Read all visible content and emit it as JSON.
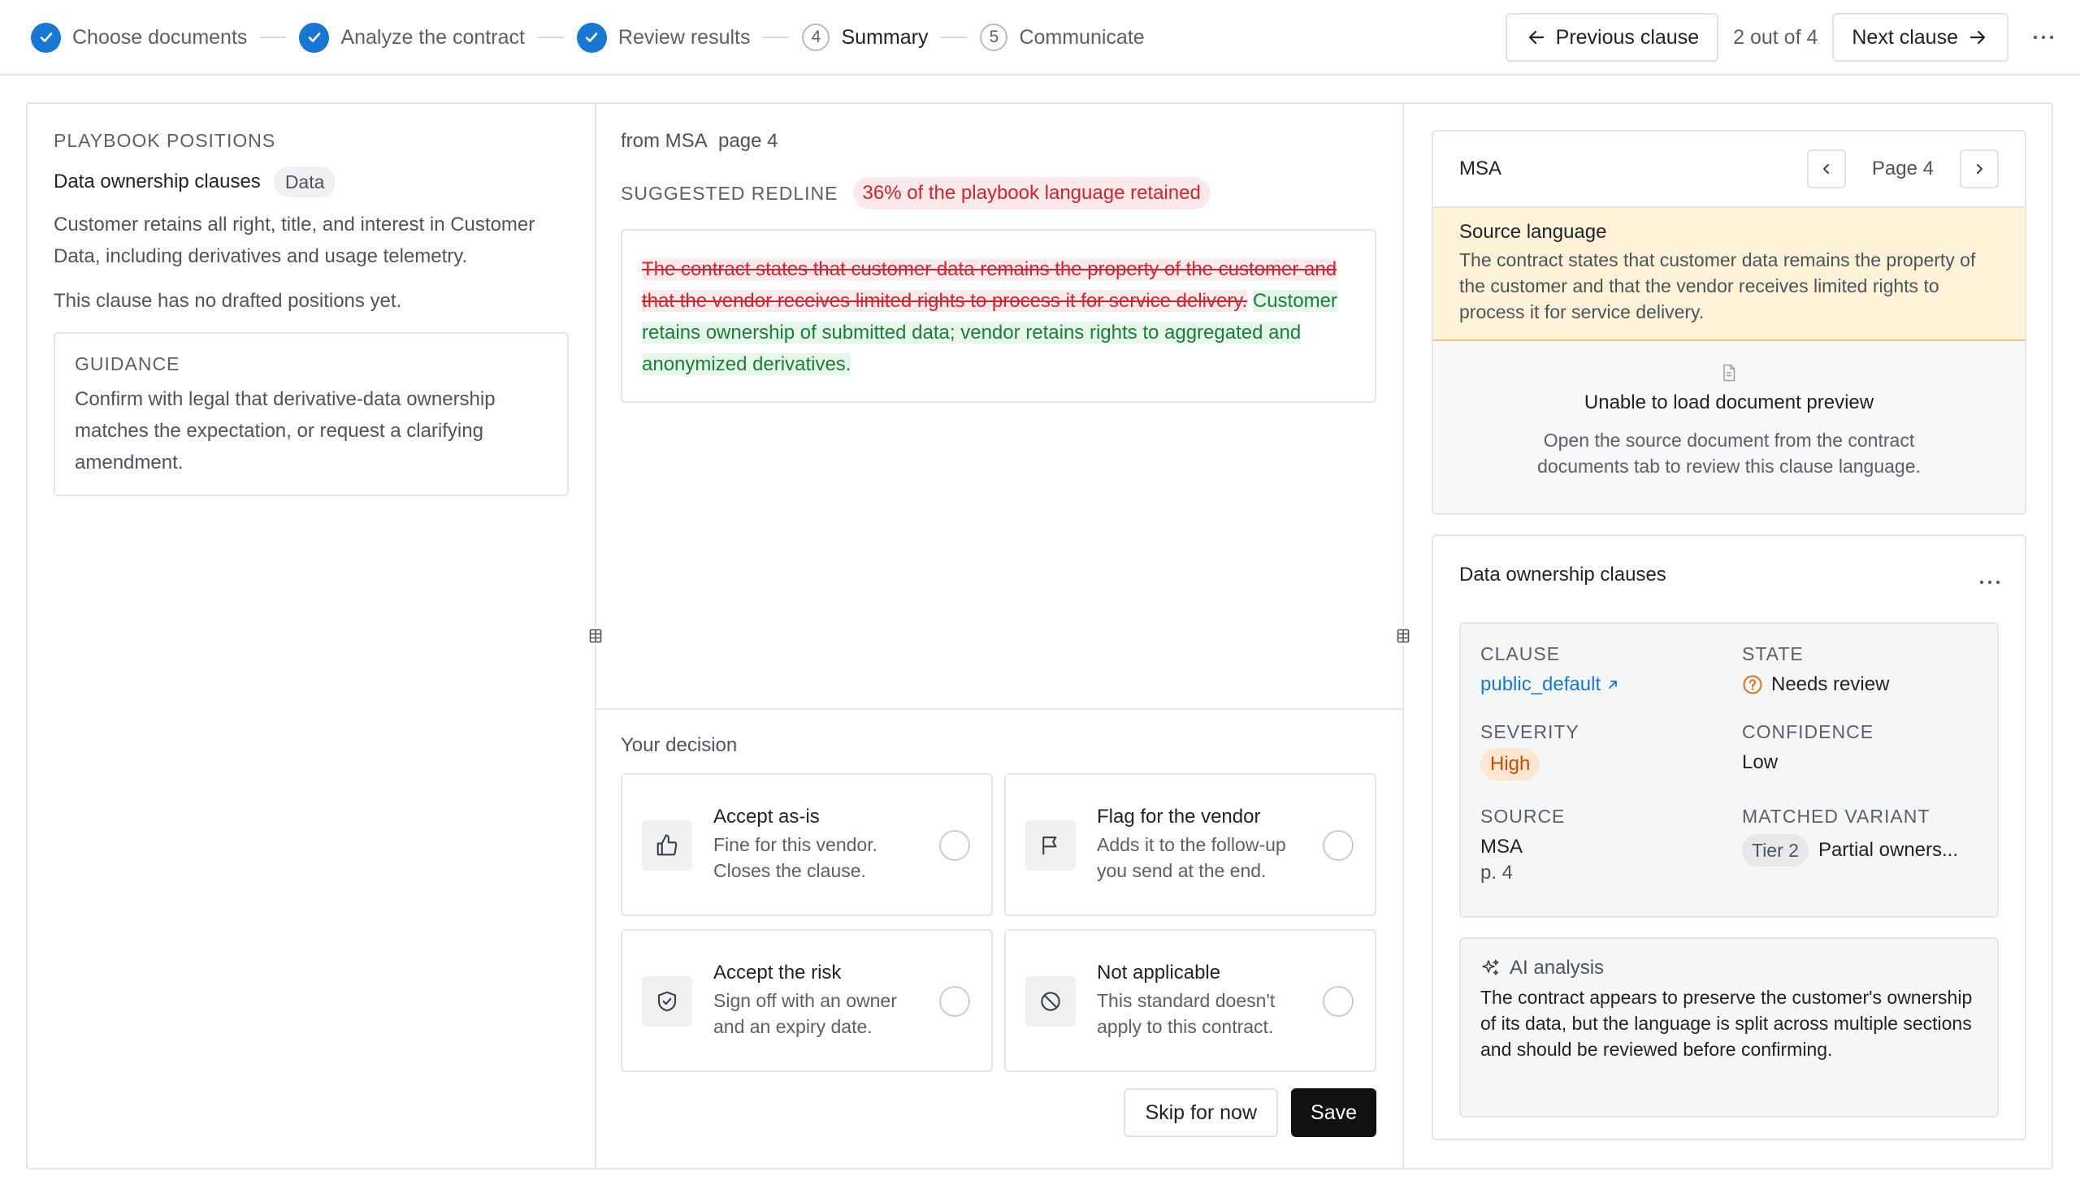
{
  "steps": [
    {
      "label": "Choose documents",
      "state": "done"
    },
    {
      "label": "Analyze the contract",
      "state": "done"
    },
    {
      "label": "Review results",
      "state": "done"
    },
    {
      "label": "Summary",
      "number": "4",
      "state": "current"
    },
    {
      "label": "Communicate",
      "number": "5",
      "state": "upcoming"
    }
  ],
  "nav": {
    "previous_label": "Previous clause",
    "counter": "2 out of 4",
    "next_label": "Next clause"
  },
  "playbook": {
    "section_title": "PLAYBOOK POSITIONS",
    "clause_name": "Data ownership clauses",
    "tag": "Data",
    "position_text": "Customer retains all right, title, and interest in Customer Data, including derivatives and usage telemetry.",
    "empty_note": "This clause has no drafted positions yet.",
    "guidance_title": "GUIDANCE",
    "guidance_text": "Confirm with legal that derivative-data ownership matches the expectation, or request a clarifying amendment."
  },
  "redline": {
    "from": "from MSA",
    "page": "page 4",
    "label": "SUGGESTED REDLINE",
    "retained": "36% of the playbook language retained",
    "deleted": "The contract states that customer data remains the property of the customer and that the vendor receives limited rights to process it for service delivery.",
    "inserted": "Customer retains ownership of submitted data; vendor retains rights to aggregated and anonymized derivatives."
  },
  "decision": {
    "label": "Your decision",
    "options": [
      {
        "title": "Accept as-is",
        "desc": "Fine for this vendor. Closes the clause.",
        "icon": "thumbs-up-icon"
      },
      {
        "title": "Flag for the vendor",
        "desc": "Adds it to the follow-up you send at the end.",
        "icon": "flag-icon"
      },
      {
        "title": "Accept the risk",
        "desc": "Sign off with an owner and an expiry date.",
        "icon": "shield-check-icon"
      },
      {
        "title": "Not applicable",
        "desc": "This standard doesn't apply to this contract.",
        "icon": "prohibited-icon"
      }
    ],
    "skip_label": "Skip for now",
    "save_label": "Save"
  },
  "document": {
    "title": "MSA",
    "page_label": "Page 4",
    "source_title": "Source language",
    "source_text": "The contract states that customer data remains the property of the customer and that the vendor receives limited rights to process it for service delivery.",
    "preview_title": "Unable to load document preview",
    "preview_text": "Open the source document from the contract documents tab to review this clause language."
  },
  "clause": {
    "title": "Data ownership clauses",
    "clause_label": "CLAUSE",
    "clause_value": "public_default",
    "state_label": "STATE",
    "state_value": "Needs review",
    "severity_label": "SEVERITY",
    "severity_value": "High",
    "confidence_label": "CONFIDENCE",
    "confidence_value": "Low",
    "source_label": "SOURCE",
    "source_value": "MSA",
    "source_page": "p. 4",
    "variant_label": "MATCHED VARIANT",
    "variant_tier": "Tier 2",
    "variant_value": "Partial owners...",
    "ai_title": "AI analysis",
    "ai_text": "The contract appears to preserve the customer's ownership of its data, but the language is split across multiple sections and should be reviewed before confirming."
  },
  "colors": {
    "accent": "#1877d2",
    "deleted": "#d1242f",
    "inserted": "#1a7f37",
    "severity_high": "#c24e00",
    "source_highlight": "#fdf1d8"
  }
}
